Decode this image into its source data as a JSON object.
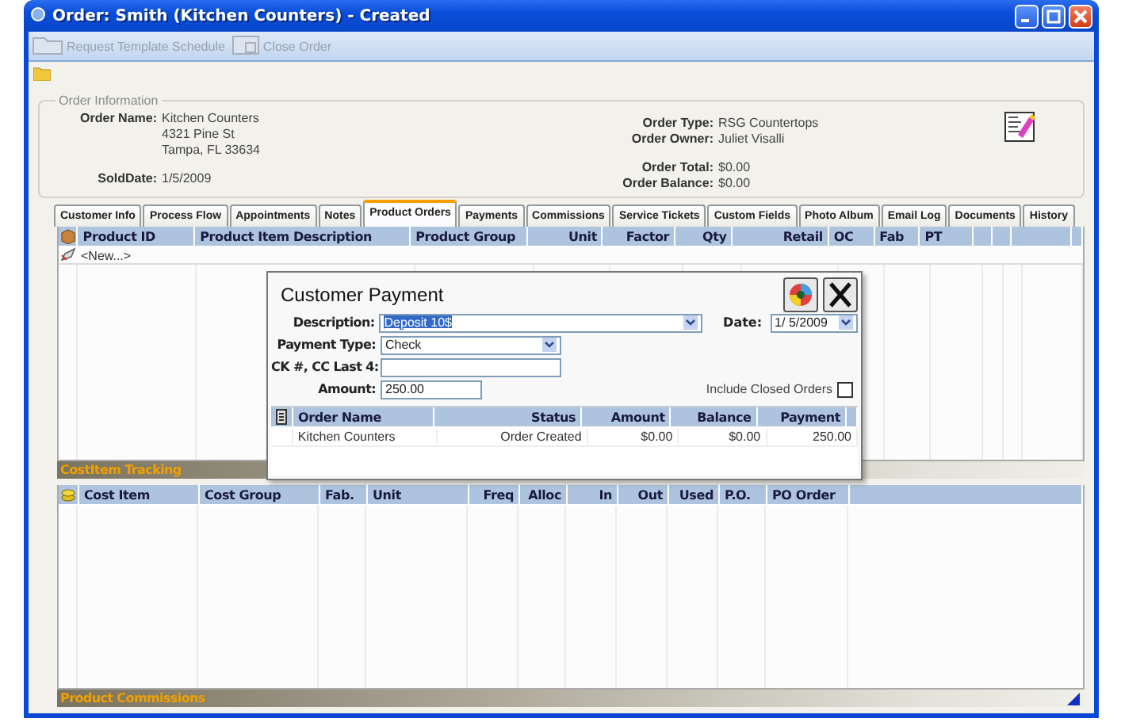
{
  "window": {
    "title": "Order: Smith (Kitchen Counters) - Created"
  },
  "toolbar": [
    {
      "label": "Request Template Schedule",
      "disabled": true
    },
    {
      "label": "Close Order",
      "disabled": true
    }
  ],
  "order_information": {
    "title": "Order Information",
    "left_fields": [
      {
        "label": "Order Name:",
        "lines": [
          "Kitchen Counters",
          "4321 Pine St",
          "Tampa, FL 33634"
        ]
      },
      {
        "label": "SoldDate:",
        "lines": [
          "1/5/2009"
        ]
      }
    ],
    "right_fields": [
      {
        "label": "Order Type:",
        "lines": [
          "RSG Countertops"
        ]
      },
      {
        "label": "Order Owner:",
        "lines": [
          "Juliet Visalli"
        ]
      },
      {
        "label": "Order Total:",
        "lines": [
          "$0.00"
        ]
      },
      {
        "label": "Order Balance:",
        "lines": [
          "$0.00"
        ]
      }
    ]
  },
  "tabs": [
    {
      "label": "Customer Info",
      "selected": false
    },
    {
      "label": "Process Flow",
      "selected": false
    },
    {
      "label": "Appointments",
      "selected": false
    },
    {
      "label": "Notes",
      "selected": false
    },
    {
      "label": "Product Orders",
      "selected": true
    },
    {
      "label": "Payments",
      "selected": false
    },
    {
      "label": "Commissions",
      "selected": false
    },
    {
      "label": "Service Tickets",
      "selected": false
    },
    {
      "label": "Custom Fields",
      "selected": false
    },
    {
      "label": "Photo Album",
      "selected": false
    },
    {
      "label": "Email Log",
      "selected": false
    },
    {
      "label": "Documents",
      "selected": false
    },
    {
      "label": "History",
      "selected": false
    }
  ],
  "product_grid": {
    "columns": [
      "Product ID",
      "Product Item Description",
      "Product Group",
      "Unit",
      "Factor",
      "Qty",
      "Retail",
      "OC",
      "Fab",
      "PT"
    ],
    "new_row": "<New...>"
  },
  "cost_item_tracking": {
    "title": "CostItem Tracking",
    "columns": [
      "Cost Item",
      "Cost Group",
      "Fab.",
      "Unit",
      "Freq",
      "Alloc",
      "In",
      "Out",
      "Used",
      "P.O.",
      "PO Order"
    ]
  },
  "product_commissions": {
    "title": "Product Commissions"
  },
  "dialog": {
    "title": "Customer Payment",
    "description": {
      "label": "Description:",
      "value": "Deposit 10$"
    },
    "date": {
      "label": "Date:",
      "value": "1/ 5/2009"
    },
    "payment_type": {
      "label": "Payment Type:",
      "value": "Check"
    },
    "ck_number": {
      "label": "CK #, CC Last 4:"
    },
    "amount": {
      "label": "Amount:",
      "value": "250.00"
    },
    "include_closed": {
      "label": "Include Closed Orders",
      "checked": false
    },
    "columns": [
      "Order Name",
      "Status",
      "Amount",
      "Balance",
      "Payment"
    ],
    "rows": [
      {
        "cells": [
          "Kitchen Counters",
          "Order Created",
          "$0.00",
          "$0.00",
          "250.00"
        ]
      }
    ]
  }
}
